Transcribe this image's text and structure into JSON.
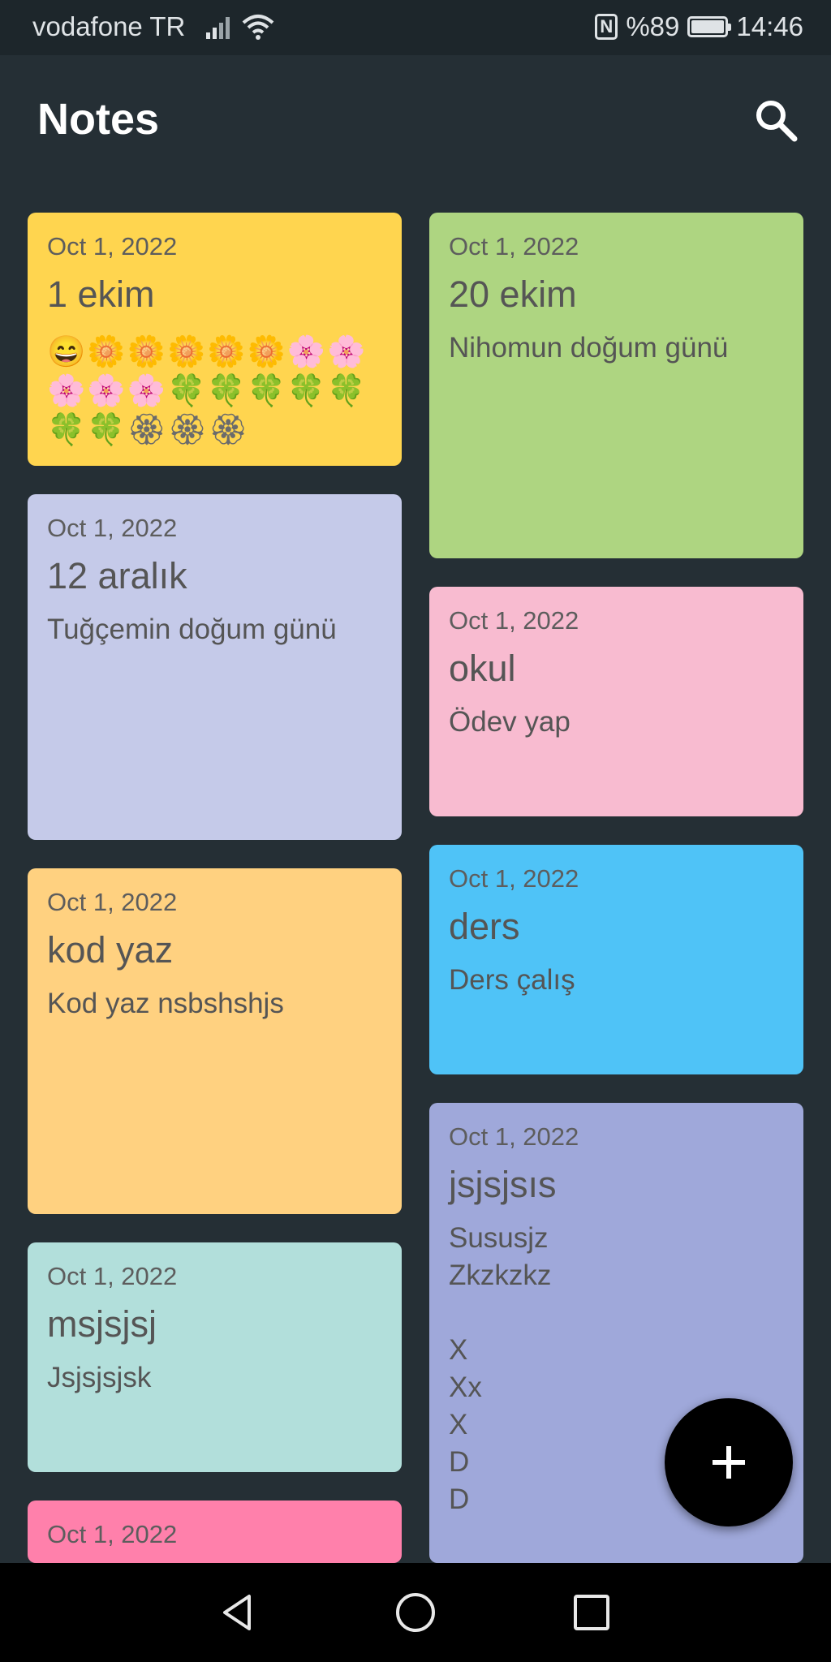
{
  "status_bar": {
    "carrier": "vodafone TR",
    "nfc": "N",
    "battery": "%89",
    "battery_level": 0.89,
    "time": "14:46"
  },
  "app_bar": {
    "title": "Notes",
    "search_icon": "search-icon"
  },
  "notes": [
    {
      "id": "n1",
      "date": "Oct 1, 2022",
      "title": "1 ekim",
      "emoji": "😄🌼🌼🌼🌼🌼🌸🌸🌸🌸🌸🍀🍀🍀🍀🍀🍀🍀🏵🏵🏵",
      "color": "#ffd54f"
    },
    {
      "id": "n2",
      "date": "Oct 1, 2022",
      "title": "20 ekim",
      "body": "Nihomun doğum günü",
      "color": "#aed581"
    },
    {
      "id": "n3",
      "date": "Oct 1, 2022",
      "title": "12 aralık",
      "body": "Tuğçemin doğum günü",
      "color": "#c5cae9"
    },
    {
      "id": "n4",
      "date": "Oct 1, 2022",
      "title": "okul",
      "body": "Ödev yap",
      "color": "#f8bbd0"
    },
    {
      "id": "n5",
      "date": "Oct 1, 2022",
      "title": "kod yaz",
      "body": "Kod yaz nsbshshjs",
      "color": "#ffd180"
    },
    {
      "id": "n6",
      "date": "Oct 1, 2022",
      "title": "ders",
      "body": "Ders çalış",
      "color": "#4fc3f7"
    },
    {
      "id": "n7",
      "date": "Oct 1, 2022",
      "title": "msjsjsj",
      "body": "Jsjsjsjsk",
      "color": "#b2dfdb"
    },
    {
      "id": "n8",
      "date": "Oct 1, 2022",
      "title": "jsjsjsıs",
      "body": "Sususjz\nZkzkzkz\n\nX\nXx\nX\nD\nD",
      "color": "#9fa8da"
    },
    {
      "id": "n9",
      "date": "Oct 1, 2022",
      "color": "#ff80ab"
    }
  ],
  "fab": {
    "icon": "add-icon"
  },
  "nav_bar": {
    "back_icon": "back-icon",
    "home_icon": "home-icon",
    "recents_icon": "recents-icon"
  }
}
